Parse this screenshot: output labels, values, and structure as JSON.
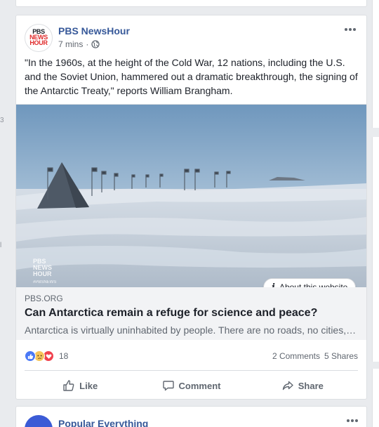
{
  "post": {
    "page_name": "PBS NewsHour",
    "time": "7 mins",
    "separator": "·",
    "avatar_logo": [
      "PBS",
      "NEWS",
      "HOUR"
    ],
    "text": "\"In the 1960s, at the height of the Cold War, 12 nations, including the U.S. and the Soviet Union, hammered out a dramatic breakthrough, the signing of the Antarctic Treaty,\" reports William Brangham.",
    "link": {
      "image_watermark": [
        "PBS",
        "NEWS",
        "HOUR",
        "#PBSNEWS"
      ],
      "about_label": "About this website",
      "domain": "PBS.ORG",
      "title": "Can Antarctica remain a refuge for science and peace?",
      "description": "Antarctica is virtually uninhabited by people. There are no roads, no cities, no permanent settlements."
    },
    "reactions": {
      "types": [
        "like",
        "sad",
        "love"
      ],
      "count": "18",
      "comments": "2 Comments",
      "shares": "5 Shares"
    },
    "actions": {
      "like": "Like",
      "comment": "Comment",
      "share": "Share"
    }
  },
  "next_post": {
    "page_name": "Popular Everything"
  },
  "left_marks": [
    "3",
    "l"
  ],
  "colors": {
    "link_blue": "#365899",
    "like_blue": "#4a79f6",
    "love_red": "#f0424e",
    "sad_yellow": "#f7c55a",
    "feed_bg": "#e9ebee"
  }
}
